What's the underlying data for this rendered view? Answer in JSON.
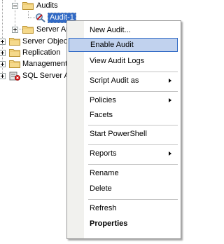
{
  "tree": {
    "audits_label": "Audits",
    "audit_item_label": "Audit-1",
    "server_audit_specs_label": "Server Audit Specifications",
    "server_objects_label": "Server Objects",
    "replication_label": "Replication",
    "management_label": "Management",
    "sql_server_agent_label": "SQL Server Agent"
  },
  "context_menu": {
    "new_audit": "New Audit...",
    "enable_audit": "Enable Audit",
    "view_audit_logs": "View Audit Logs",
    "script_audit_as": "Script Audit as",
    "policies": "Policies",
    "facets": "Facets",
    "start_powershell": "Start PowerShell",
    "reports": "Reports",
    "rename": "Rename",
    "delete": "Delete",
    "refresh": "Refresh",
    "properties": "Properties"
  },
  "colors": {
    "selection": "#316ac5",
    "menu_highlight": "#c1d2ee",
    "folder": "#f5d98b"
  }
}
